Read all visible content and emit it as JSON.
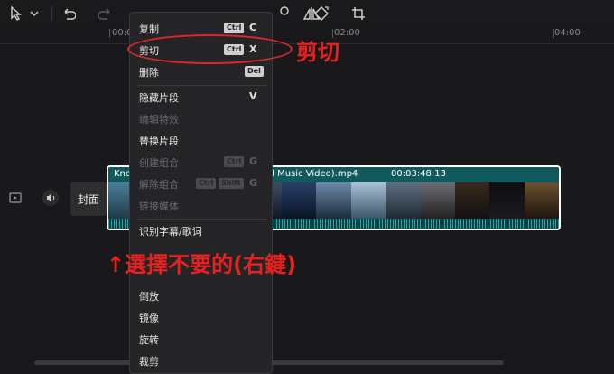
{
  "toolbar": {
    "icons": [
      "cursor-icon",
      "chevron-down-icon",
      "undo-icon",
      "redo-icon",
      "split-icon",
      "delete-icon",
      "freeze-icon",
      "record-icon",
      "mirror-icon",
      "rotate-icon",
      "crop-icon"
    ]
  },
  "ruler": {
    "labels": [
      "00:00",
      "02:00",
      "04:00"
    ]
  },
  "timeline": {
    "cover_label": "封面",
    "clip_name": "Knockin' On Heaven's Door (Official Music Video).mp4",
    "clip_duration": "00:03:48:13"
  },
  "context_menu": {
    "items": [
      {
        "label": "复制",
        "mod": "Ctrl",
        "key": "C",
        "enabled": true
      },
      {
        "label": "剪切",
        "mod": "Ctrl",
        "key": "X",
        "enabled": true
      },
      {
        "label": "删除",
        "mod": "Del",
        "key": "",
        "enabled": true
      },
      {
        "label": "隐藏片段",
        "mod": "",
        "key": "V",
        "enabled": true
      },
      {
        "label": "编辑特效",
        "mod": "",
        "key": "",
        "enabled": false
      },
      {
        "label": "替换片段",
        "mod": "",
        "key": "",
        "enabled": true
      },
      {
        "label": "创建组合",
        "mod": "Ctrl",
        "key": "G",
        "enabled": false
      },
      {
        "label": "解除组合",
        "mod": "Ctrl",
        "mod2": "Shift",
        "key": "G",
        "enabled": false
      },
      {
        "label": "链接媒体",
        "mod": "",
        "key": "",
        "enabled": false
      },
      {
        "label": "识别字幕/歌词",
        "mod": "",
        "key": "",
        "enabled": true
      },
      {
        "label": "倒放",
        "mod": "",
        "key": "",
        "enabled": true
      },
      {
        "label": "镜像",
        "mod": "",
        "key": "",
        "enabled": true
      },
      {
        "label": "旋转",
        "mod": "",
        "key": "",
        "enabled": true
      },
      {
        "label": "裁剪",
        "mod": "",
        "key": "",
        "enabled": true
      }
    ]
  },
  "annotations": {
    "cut_label": "剪切",
    "instruction": "↑選擇不要的(右鍵)",
    "color": "#e8211f"
  }
}
